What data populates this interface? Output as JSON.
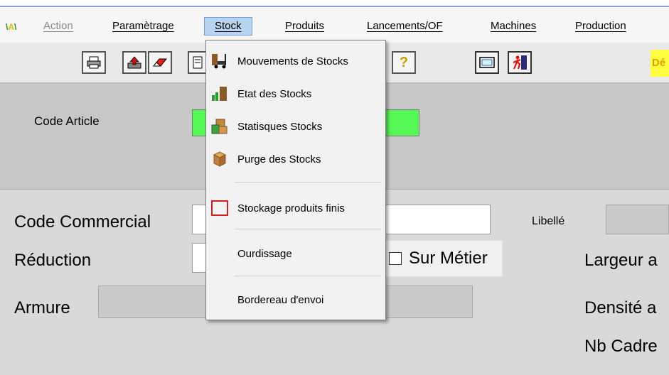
{
  "menubar": {
    "items": [
      {
        "label": "Action",
        "state": "disabled"
      },
      {
        "label": "Paramètrage",
        "state": "normal"
      },
      {
        "label": "Stock",
        "state": "active"
      },
      {
        "label": "Produits",
        "state": "normal"
      },
      {
        "label": "Lancements/OF",
        "state": "normal"
      },
      {
        "label": "Machines",
        "state": "normal"
      },
      {
        "label": "Production",
        "state": "normal"
      }
    ]
  },
  "toolbar": {
    "buttons": [
      {
        "icon": "printer-icon"
      },
      {
        "icon": "upload-icon"
      },
      {
        "icon": "eraser-icon"
      },
      {
        "icon": "document-icon"
      },
      {
        "icon": "help-icon",
        "glyph": "?"
      },
      {
        "icon": "monitor-icon"
      },
      {
        "icon": "exit-icon"
      }
    ],
    "flag_text": "Dé"
  },
  "stock_menu": {
    "items": [
      {
        "label": "Mouvements de Stocks",
        "icon": "forklift-icon"
      },
      {
        "label": "Etat des Stocks",
        "icon": "stock-chart-icon"
      },
      {
        "label": "Statisques Stocks",
        "icon": "boxes-icon"
      },
      {
        "label": "Purge des Stocks",
        "icon": "box-icon"
      },
      {
        "label": "Stockage produits finis",
        "icon": "empty-frame-icon"
      },
      {
        "label": "Ourdissage",
        "icon": ""
      },
      {
        "label": "Bordereau d'envoi",
        "icon": ""
      }
    ]
  },
  "form": {
    "code_article_label": "Code Article",
    "code_commercial_label": "Code Commercial",
    "libelle_label": "Libellé",
    "reduction_label": "Réduction",
    "sur_metier_label": "Sur Métier",
    "armure_label": "Armure",
    "largeur_label": "Largeur a",
    "densite_label": "Densité a",
    "nb_cadre_label": "Nb Cadre"
  },
  "colors": {
    "highlight_field": "#55f755",
    "menu_active_bg": "#b8d4f2",
    "toolbar_flag": "#ffff40"
  }
}
